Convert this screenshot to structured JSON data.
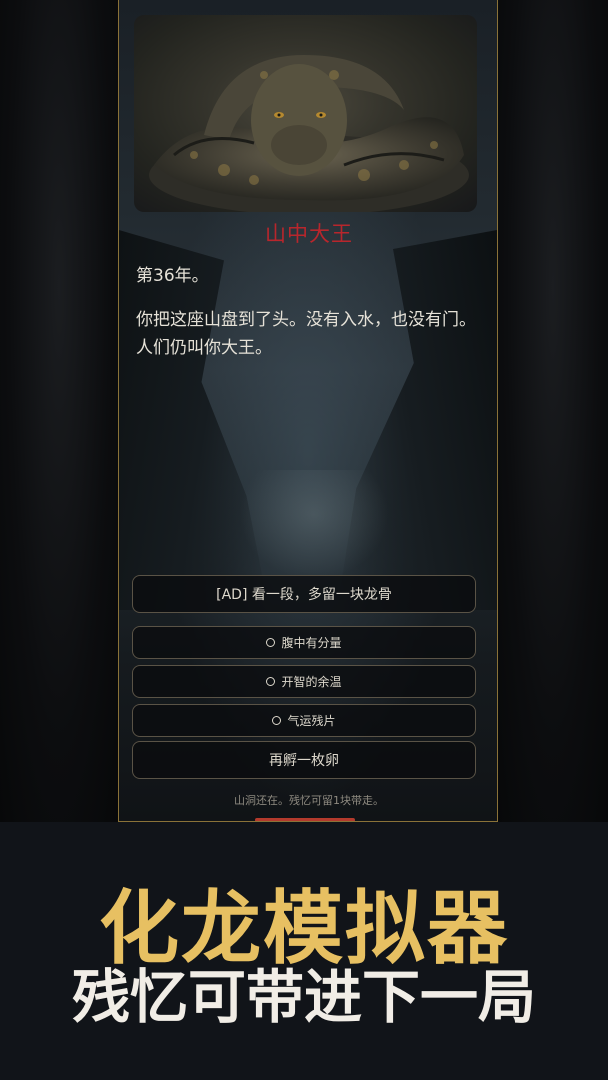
{
  "game": {
    "chapter_title": "山中大王",
    "story": [
      "第36年。",
      "你把这座山盘到了头。没有入水，也没有门。人们仍叫你大王。"
    ],
    "ad_button": "[AD] 看一段，多留一块龙骨",
    "options": [
      "腹中有分量",
      "开智的余温",
      "气运残片"
    ],
    "hatch_button": "再孵一枚卵",
    "footer_note": "山洞还在。残忆可留1块带走。",
    "progress": 0.3
  },
  "banner": {
    "title": "化龙模拟器",
    "subtitle": "残忆可带进下一局"
  },
  "colors": {
    "accent_gold": "#e7c062",
    "title_red": "#b8262c",
    "frame_gold": "#8a7238"
  }
}
